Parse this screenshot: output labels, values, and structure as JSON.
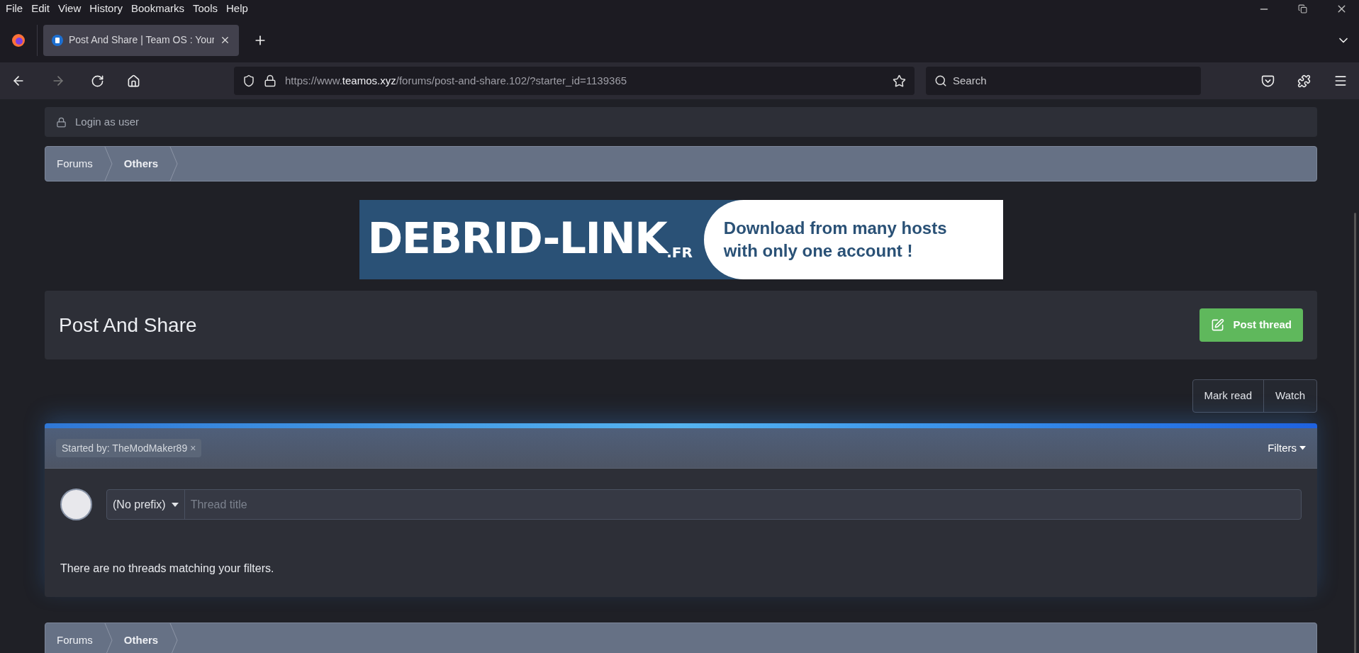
{
  "menu_bar": [
    "File",
    "Edit",
    "View",
    "History",
    "Bookmarks",
    "Tools",
    "Help"
  ],
  "tabs": [
    {
      "title": "Post And Share | Team OS : Your",
      "selected": true
    }
  ],
  "address_bar": {
    "url_scheme": "https://www.",
    "url_domain": "teamos.xyz",
    "url_rest": "/forums/post-and-share.102/?starter_id=1139365"
  },
  "search": {
    "placeholder": "Search"
  },
  "login_bar": {
    "label": "Login as user"
  },
  "breadcrumb_top": [
    {
      "label": "Forums",
      "current": false
    },
    {
      "label": "Others",
      "current": true
    }
  ],
  "banner": {
    "logo": "DEBRID-LINK",
    "logo_suffix": ".FR",
    "tagline": "Download from many hosts with only one account !"
  },
  "forum": {
    "title": "Post And Share",
    "post_button": "Post thread"
  },
  "actions": [
    "Mark read",
    "Watch"
  ],
  "filter_bar": {
    "active_filter": "Started by: TheModMaker89",
    "remove": "×",
    "filters_button": "Filters"
  },
  "new_thread": {
    "prefix": "(No prefix)",
    "placeholder": "Thread title"
  },
  "empty_message": "There are no threads matching your filters.",
  "breadcrumb_bottom": [
    {
      "label": "Forums",
      "current": false
    },
    {
      "label": "Others",
      "current": true
    }
  ]
}
